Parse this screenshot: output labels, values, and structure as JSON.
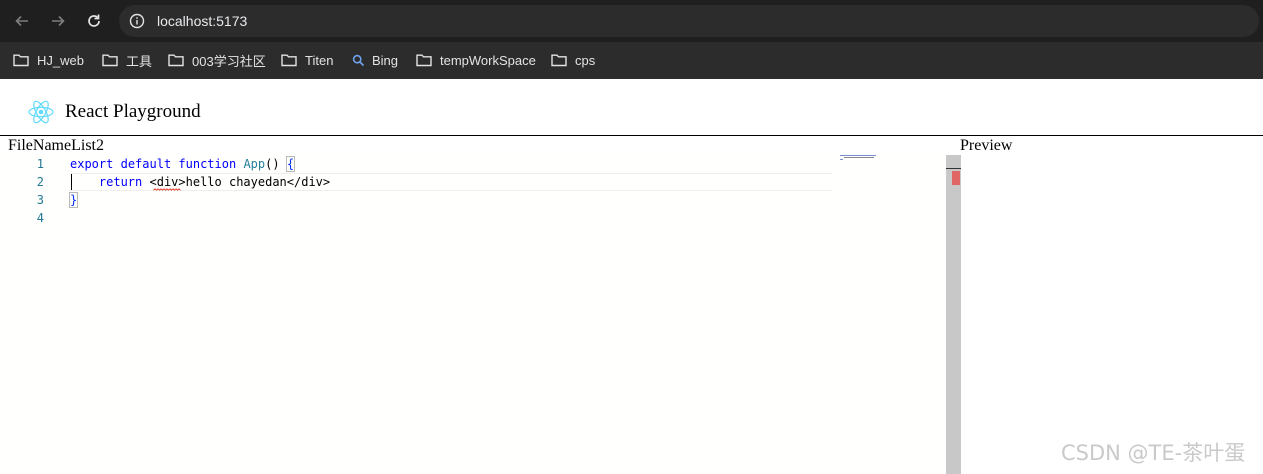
{
  "browser": {
    "url": "localhost:5173",
    "bookmarks": [
      {
        "label": "HJ_web",
        "icon": "folder-icon"
      },
      {
        "label": "工具",
        "icon": "folder-icon"
      },
      {
        "label": "003学习社区",
        "icon": "folder-icon"
      },
      {
        "label": "Titen",
        "icon": "folder-icon"
      },
      {
        "label": "Bing",
        "icon": "search-icon"
      },
      {
        "label": "tempWorkSpace",
        "icon": "folder-icon"
      },
      {
        "label": "cps",
        "icon": "folder-icon"
      }
    ]
  },
  "app": {
    "title": "React Playground",
    "file_list_label": "FileNameList2",
    "preview_label": "Preview"
  },
  "editor": {
    "line_numbers": [
      "1",
      "2",
      "3",
      "4"
    ],
    "line1": {
      "kw1": "export",
      "kw2": "default",
      "kw3": "function",
      "fn": "App",
      "punct": "() ",
      "brace": "{"
    },
    "line2": {
      "kw": "return",
      "tag_open": "<div>",
      "text": "hello chayedan",
      "tag_close": "</div>"
    },
    "line3": {
      "brace": "}"
    }
  },
  "watermark": "CSDN @TE-茶叶蛋",
  "colors": {
    "keyword": "#0000ff",
    "function": "#267f99",
    "line_number": "#237893",
    "chrome_bg": "#1f1f1f"
  }
}
